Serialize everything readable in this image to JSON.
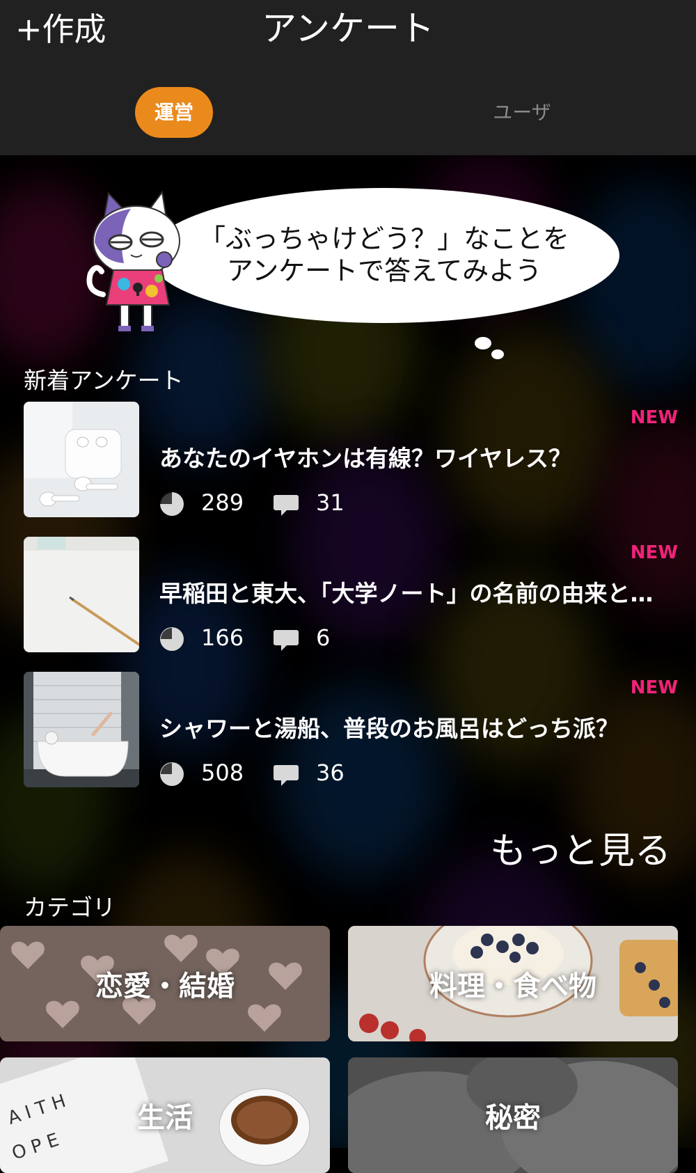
{
  "header": {
    "create_label": "+作成",
    "title": "アンケート",
    "tabs": [
      {
        "label": "運営",
        "active": true
      },
      {
        "label": "ユーザ",
        "active": false
      }
    ]
  },
  "banner": {
    "line1": "「ぶっちゃけどう？」なことを",
    "line2": "アンケートで答えてみよう"
  },
  "new_surveys": {
    "title": "新着アンケート",
    "items": [
      {
        "badge": "NEW",
        "title": "あなたのイヤホンは有線？ワイヤレス？",
        "votes": "289",
        "comments": "31"
      },
      {
        "badge": "NEW",
        "title": "早稲田と東大、「大学ノート」の名前の由来と…",
        "votes": "166",
        "comments": "6"
      },
      {
        "badge": "NEW",
        "title": "シャワーと湯船、普段のお風呂はどっち派？",
        "votes": "508",
        "comments": "36"
      }
    ],
    "more_label": "もっと見る"
  },
  "categories": {
    "title": "カテゴリ",
    "items": [
      {
        "label": "恋愛・結婚"
      },
      {
        "label": "料理・食べ物"
      },
      {
        "label": "生活"
      },
      {
        "label": "秘密"
      }
    ]
  },
  "colors": {
    "header_bg": "#212121",
    "accent": "#ea8a1d",
    "new_badge": "#f0237a"
  }
}
